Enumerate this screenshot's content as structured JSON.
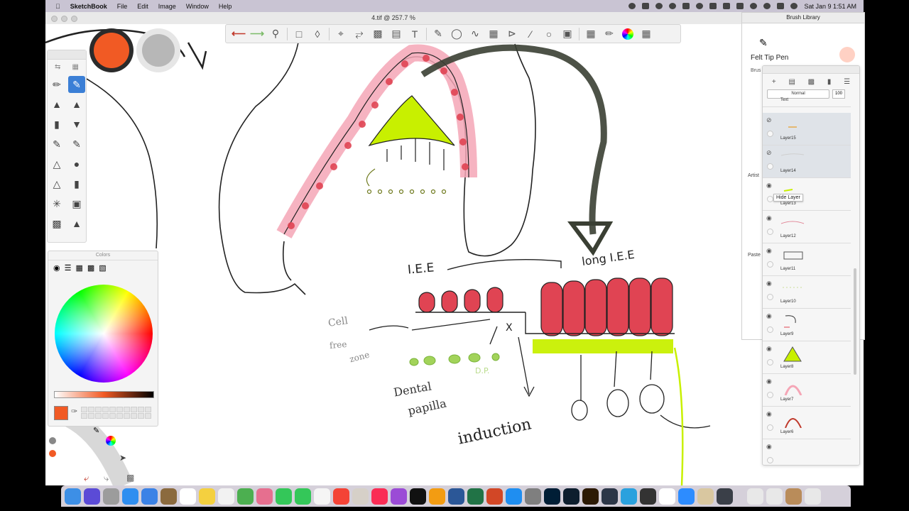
{
  "menubar": {
    "app_name": "SketchBook",
    "menus": [
      "File",
      "Edit",
      "Image",
      "Window",
      "Help"
    ],
    "clock": "Sat Jan 9  1:51 AM"
  },
  "window": {
    "title": "4.tif @ 257.7 %"
  },
  "colors_panel": {
    "title": "Colors",
    "current_color": "#f15a24"
  },
  "brush_library": {
    "title": "Brush Library",
    "brush_name": "Felt Tip Pen",
    "brush_sub": "Brus",
    "sections": [
      "Artist",
      "Paste"
    ]
  },
  "layers": {
    "blend_mode": "Normal",
    "opacity": "100",
    "tooltip": "Hide Layer",
    "items": [
      {
        "name": "Text"
      },
      {
        "name": "Layer15"
      },
      {
        "name": "Layer14"
      },
      {
        "name": "Layer13"
      },
      {
        "name": "Layer12"
      },
      {
        "name": "Layer11"
      },
      {
        "name": "Layer10"
      },
      {
        "name": "Layer9"
      },
      {
        "name": "Layer8"
      },
      {
        "name": "Layer7"
      },
      {
        "name": "Layer6"
      }
    ]
  },
  "drawing_labels": {
    "iee": "I.E.E",
    "long_iee": "long I.E.E",
    "cell_free_1": "Cell",
    "cell_free_2": "free",
    "cell_free_3": "zone",
    "dp": "D.P.",
    "dental_1": "Dental",
    "dental_2": "papilla",
    "induction": "induction",
    "x_mark": "X"
  },
  "accent_colors": {
    "brush_orange": "#f15a24",
    "cell_red": "#e04453",
    "cell_pink": "#f5a6b6",
    "highlight_yellow": "#c8f000",
    "arrow_dark": "#3a3f33"
  }
}
